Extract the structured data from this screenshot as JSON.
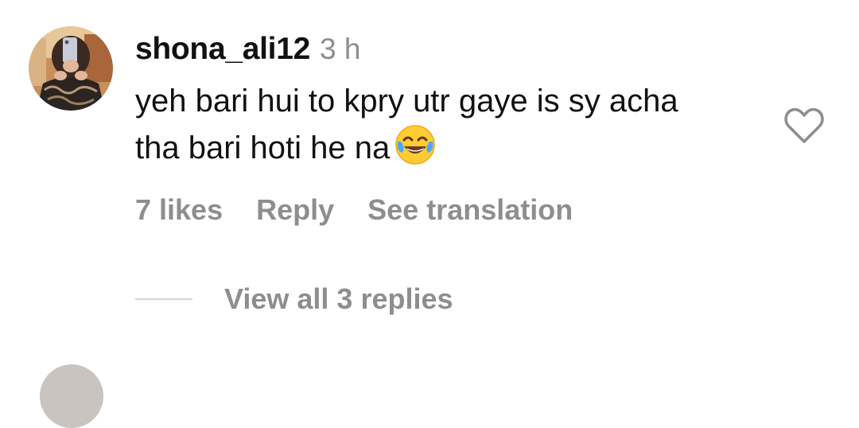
{
  "comment": {
    "username": "shona_ali12",
    "timestamp": "3 h",
    "text_line1": "yeh bari hui to kpry utr gaye is sy acha",
    "text_line2": "tha bari hoti he na",
    "emoji": "face-with-tears-of-joy",
    "likes_label": "7 likes",
    "reply_label": "Reply",
    "translation_label": "See translation",
    "view_replies_label": "View all 3 replies"
  },
  "icons": {
    "like": "heart-outline-icon",
    "emoji": "face-with-tears-of-joy-emoji"
  },
  "colors": {
    "primary_text": "#111111",
    "secondary_text": "#8e8e8e",
    "divider": "#d6d6d6",
    "background": "#ffffff"
  }
}
